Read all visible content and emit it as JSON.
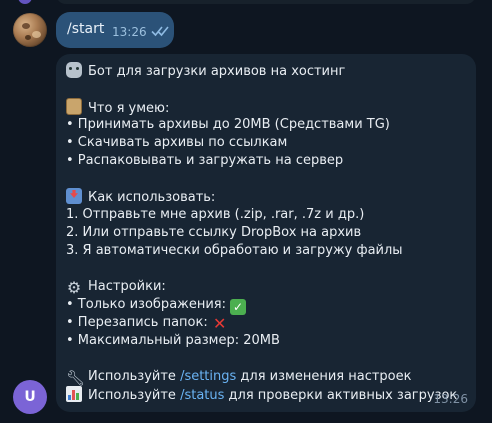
{
  "outgoing": {
    "text": "/start",
    "time": "13:26"
  },
  "bot": {
    "avatar_letter": "U",
    "time": "13:26",
    "title": "Бот для загрузки архивов на хостинг",
    "can_header": "Что я умею:",
    "can_items": [
      "• Принимать архивы до 20MB (Средствами TG)",
      "• Скачивать архивы по ссылкам",
      "• Распаковывать и загружать на сервер"
    ],
    "how_header": "Как использовать:",
    "how_items": [
      "1. Отправьте мне архив (.zip, .rar, .7z и др.)",
      "2. Или отправьте ссылку DropBox на архив",
      "3. Я автоматически обработаю и загружу файлы"
    ],
    "settings_header": "Настройки:",
    "settings_items": {
      "images_only": "• Только изображения:",
      "overwrite": "• Перезапись папок:",
      "max_size": "• Максимальный размер: 20MB"
    },
    "settings_cmd": {
      "prefix": "Используйте ",
      "cmd": "/settings",
      "suffix": " для изменения настроек"
    },
    "status_cmd": {
      "prefix": "Используйте ",
      "cmd": "/status",
      "suffix": " для проверки активных загрузок"
    }
  },
  "colors": {
    "background": "#0e1621",
    "outgoing_bubble": "#2b5278",
    "incoming_bubble": "#182533",
    "link": "#6ab3f3",
    "bot_avatar": "#7b64d6"
  },
  "icons": {
    "title": "robot-icon",
    "can": "clipboard-icon",
    "how": "inbox-tray-icon",
    "settings": "gear-icon",
    "settings_cmd": "wrench-icon",
    "status_cmd": "bar-chart-icon",
    "enabled": "check-mark-button-icon",
    "disabled": "cross-mark-icon",
    "read": "double-check-icon"
  }
}
